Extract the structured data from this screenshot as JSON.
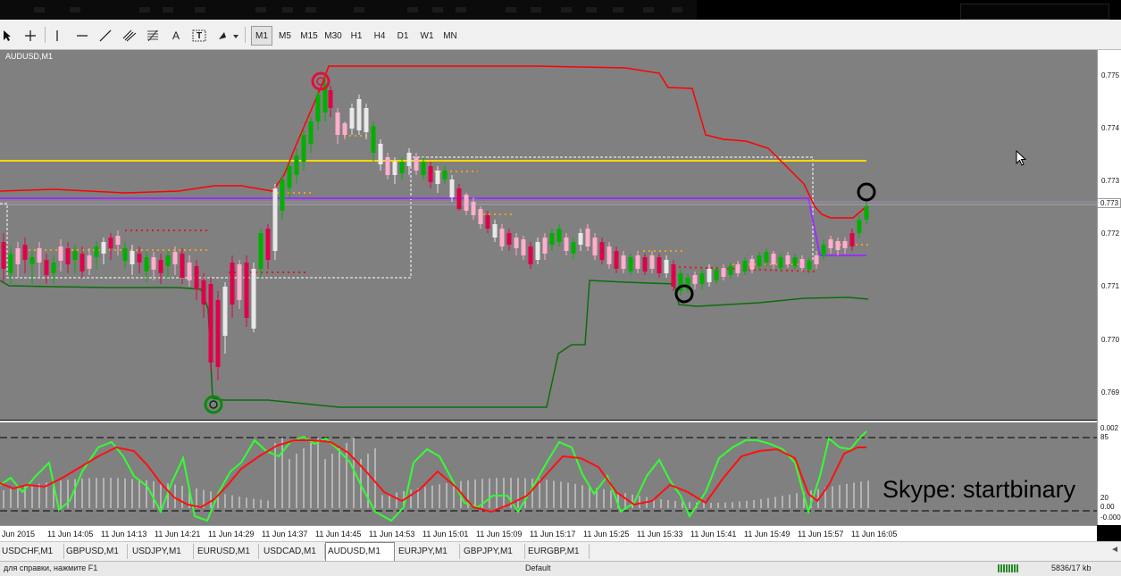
{
  "toolbar": {
    "tools": [
      "cursor-icon",
      "crosshair-icon",
      "vertical-line-icon",
      "horizontal-line-icon",
      "trendline-icon",
      "channel-icon",
      "fibonacci-icon",
      "text-icon",
      "text-label-icon",
      "shapes-icon"
    ],
    "text_tool_label": "A",
    "text_label_tool_label": "T",
    "timeframes": [
      "M1",
      "M5",
      "M15",
      "M30",
      "H1",
      "H4",
      "D1",
      "W1",
      "MN"
    ],
    "active_timeframe": "M1"
  },
  "chart": {
    "symbol": "AUDUSD,M1",
    "price_labels": [
      "0.775",
      "0.774",
      "0.773",
      "0.773",
      "0.772",
      "0.771",
      "0.770",
      "0.769"
    ],
    "current_price": "0.773",
    "watermark": "Skype: startbinary",
    "colors": {
      "background": "#808080",
      "bull_candle": "#00b000",
      "bear_candle": "#e0004a",
      "bull_body_alt": "#e8e8e8",
      "bear_body_alt": "#ffaecd",
      "upper_band": "#ff0000",
      "lower_band": "#006400",
      "yellow_level": "#ffd700",
      "purple_level": "#9b30ff"
    }
  },
  "indicator": {
    "levels": [
      "0.002",
      "85",
      "20",
      "0.00",
      "-0.000"
    ],
    "colors": {
      "fast_line": "#33ff33",
      "slow_line": "#ff0000",
      "histogram": "#dcdcdc"
    }
  },
  "time_axis": [
    "Jun 2015",
    "11 Jun 14:05",
    "11 Jun 14:13",
    "11 Jun 14:21",
    "11 Jun 14:29",
    "11 Jun 14:37",
    "11 Jun 14:45",
    "11 Jun 14:53",
    "11 Jun 15:01",
    "11 Jun 15:09",
    "11 Jun 15:17",
    "11 Jun 15:25",
    "11 Jun 15:33",
    "11 Jun 15:41",
    "11 Jun 15:49",
    "11 Jun 15:57",
    "11 Jun 16:05"
  ],
  "tabs": [
    "USDCHF,M1",
    "GBPUSD,M1",
    "USDJPY,M1",
    "EURUSD,M1",
    "USDCAD,M1",
    "AUDUSD,M1",
    "EURJPY,M1",
    "GBPJPY,M1",
    "EURGBP,M1"
  ],
  "active_tab": "AUDUSD,M1",
  "status": {
    "left": "для справки, нажмите F1",
    "middle": "Default",
    "right": "5836/17 kb"
  }
}
